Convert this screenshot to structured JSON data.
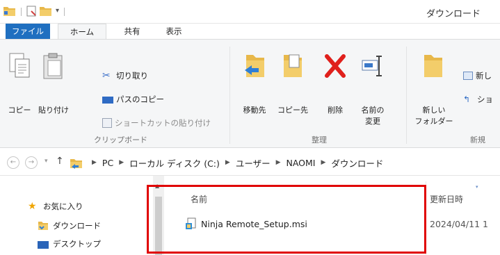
{
  "window": {
    "title": "ダウンロード"
  },
  "tabs": [
    {
      "label": "ファイル"
    },
    {
      "label": "ホーム"
    },
    {
      "label": "共有"
    },
    {
      "label": "表示"
    }
  ],
  "ribbon": {
    "clipboard": {
      "copy": "コピー",
      "paste": "貼り付け",
      "cut": "切り取り",
      "copy_path": "パスのコピー",
      "paste_shortcut": "ショートカットの貼り付け",
      "group_label": "クリップボード"
    },
    "organize": {
      "move_to": "移動先",
      "copy_to": "コピー先",
      "delete": "削除",
      "rename_line1": "名前の",
      "rename_line2": "変更",
      "group_label": "整理"
    },
    "new": {
      "new_folder_line1": "新しい",
      "new_folder_line2": "フォルダー",
      "new_item": "新し",
      "easy_access": "ショ",
      "group_label": "新規"
    }
  },
  "address": {
    "crumbs": [
      "PC",
      "ローカル ディスク (C:)",
      "ユーザー",
      "NAOMI",
      "ダウンロード"
    ]
  },
  "navpane": {
    "favorites": "お気に入り",
    "downloads": "ダウンロード",
    "desktop": "デスクトップ"
  },
  "content": {
    "col_name": "名前",
    "col_modified": "更新日時",
    "files": [
      {
        "name": "Ninja Remote_Setup.msi",
        "modified": "2024/04/11 1"
      }
    ]
  },
  "colors": {
    "accent": "#1f6fc0",
    "highlight": "#e00000",
    "folder": "#e8b84a"
  }
}
